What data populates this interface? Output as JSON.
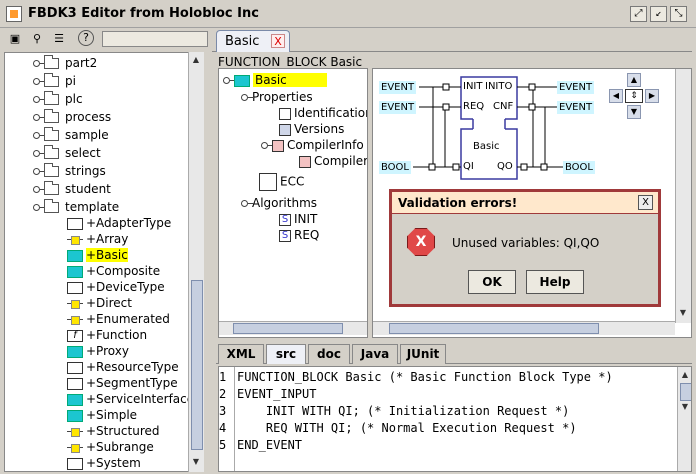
{
  "window": {
    "title": "FBDK3 Editor from Holobloc Inc",
    "controls": [
      "restore-icon",
      "minimize-icon",
      "maximize-icon"
    ]
  },
  "tree": {
    "items": [
      {
        "label": "part2"
      },
      {
        "label": "pi"
      },
      {
        "label": "plc"
      },
      {
        "label": "process"
      },
      {
        "label": "sample"
      },
      {
        "label": "select"
      },
      {
        "label": "strings"
      },
      {
        "label": "student"
      },
      {
        "label": "template"
      }
    ],
    "template_items": [
      {
        "label": "+AdapterType",
        "icon": "adapter-icon"
      },
      {
        "label": "+Array",
        "icon": "fb-icon"
      },
      {
        "label": "+Basic",
        "icon": "basic-fb-icon",
        "selected": true
      },
      {
        "label": "+Composite",
        "icon": "composite-fb-icon"
      },
      {
        "label": "+DeviceType",
        "icon": "device-icon"
      },
      {
        "label": "+Direct",
        "icon": "fb-icon"
      },
      {
        "label": "+Enumerated",
        "icon": "fb-icon"
      },
      {
        "label": "+Function",
        "icon": "function-icon"
      },
      {
        "label": "+Proxy",
        "icon": "proxy-icon"
      },
      {
        "label": "+ResourceType",
        "icon": "resource-icon"
      },
      {
        "label": "+SegmentType",
        "icon": "segment-icon"
      },
      {
        "label": "+ServiceInterface",
        "icon": "service-icon"
      },
      {
        "label": "+Simple",
        "icon": "simple-fb-icon"
      },
      {
        "label": "+Structured",
        "icon": "fb-icon"
      },
      {
        "label": "+Subrange",
        "icon": "fb-icon"
      },
      {
        "label": "+System",
        "icon": "system-icon"
      }
    ]
  },
  "editor": {
    "tab_label": "Basic",
    "tab_close": "X",
    "header": "FUNCTION_BLOCK Basic",
    "outline": {
      "root": "Basic",
      "properties": "Properties",
      "identification": "Identification",
      "versions": "Versions",
      "compilerinfo": "CompilerInfo",
      "compiler": "Compiler",
      "ecc": "ECC",
      "algorithms": "Algorithms",
      "init": "INIT",
      "req": "REQ"
    },
    "diagram": {
      "in_events": [
        "EVENT",
        "EVENT"
      ],
      "out_events": [
        "EVENT",
        "EVENT"
      ],
      "in_data": "BOOL",
      "out_data": "BOOL",
      "ports": {
        "init": "INIT",
        "inito": "INITO",
        "req": "REQ",
        "cnf": "CNF",
        "qi": "QI",
        "qo": "QO"
      },
      "block_name": "Basic"
    }
  },
  "dialog": {
    "title": "Validation errors!",
    "close": "X",
    "icon": "error-icon",
    "message": "Unused variables: QI,QO",
    "ok_label": "OK",
    "help_label": "Help"
  },
  "bottom_tabs": [
    {
      "label": "XML"
    },
    {
      "label": "src",
      "active": true
    },
    {
      "label": "doc"
    },
    {
      "label": "Java"
    },
    {
      "label": "JUnit"
    }
  ],
  "code": [
    {
      "n": "1",
      "text": "FUNCTION_BLOCK Basic (* Basic Function Block Type *)"
    },
    {
      "n": "2",
      "text": "EVENT_INPUT"
    },
    {
      "n": "3",
      "text": "    INIT WITH QI; (* Initialization Request *)"
    },
    {
      "n": "4",
      "text": "    REQ WITH QI; (* Normal Execution Request *)"
    },
    {
      "n": "5",
      "text": "END_EVENT"
    }
  ]
}
